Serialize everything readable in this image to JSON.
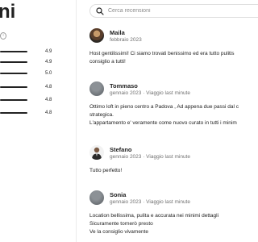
{
  "header": {
    "title_visible": "ni",
    "info_icon": "info-icon"
  },
  "ratings": [
    {
      "value": "4.9"
    },
    {
      "value": "4.9"
    },
    {
      "value": "5.0"
    },
    {
      "value": "4.8"
    },
    {
      "value": "4.8"
    },
    {
      "value": "4.8"
    }
  ],
  "search": {
    "placeholder": "Cerca recensioni",
    "icon": "search-icon"
  },
  "reviews": [
    {
      "name": "Maila",
      "date": "febbraio 2023",
      "avatar": "photo",
      "lines": [
        "Host gentilissimi! Ci siamo trovati benissimo ed era tutto pulitis",
        "consiglio a tutti!"
      ]
    },
    {
      "name": "Tommaso",
      "date": "gennaio 2023 · Viaggio last minute",
      "avatar": "grey",
      "lines": [
        "Ottimo loft in pieno centro a Padova , Ad appena due passi dal c",
        "strategica.",
        "L'appartamento e' veramente come nuovo curato in tutti i minim"
      ]
    },
    {
      "name": "Stefano",
      "date": "gennaio 2023 · Viaggio last minute",
      "avatar": "man",
      "lines": [
        "Tutto perfetto!"
      ]
    },
    {
      "name": "Sonia",
      "date": "gennaio 2023 · Viaggio last minute",
      "avatar": "grey",
      "lines": [
        "Location bellissima, pulita e accurata nei minimi dettagli",
        "Sicuramente tornerò presto",
        "Ve la consiglio vivamente"
      ]
    }
  ]
}
